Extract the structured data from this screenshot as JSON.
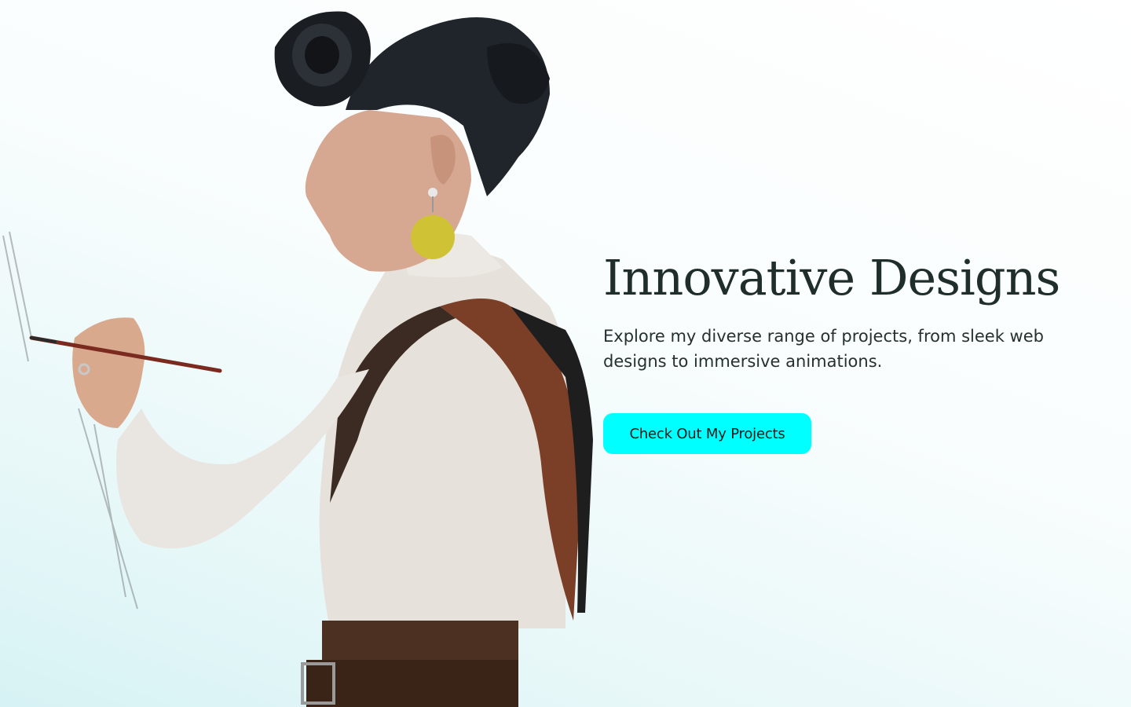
{
  "hero": {
    "title": "Innovative Designs",
    "subtitle": "Explore my diverse range of projects, from sleek web designs to immersive animations.",
    "cta_label": "Check Out My Projects",
    "image_alt": "woman-painting-illustration"
  },
  "colors": {
    "cta_background": "#00ffff",
    "title_text": "#1f2d2b",
    "body_text": "#26302f",
    "background_start": "#ffffff",
    "background_end": "#d6f2f4"
  }
}
